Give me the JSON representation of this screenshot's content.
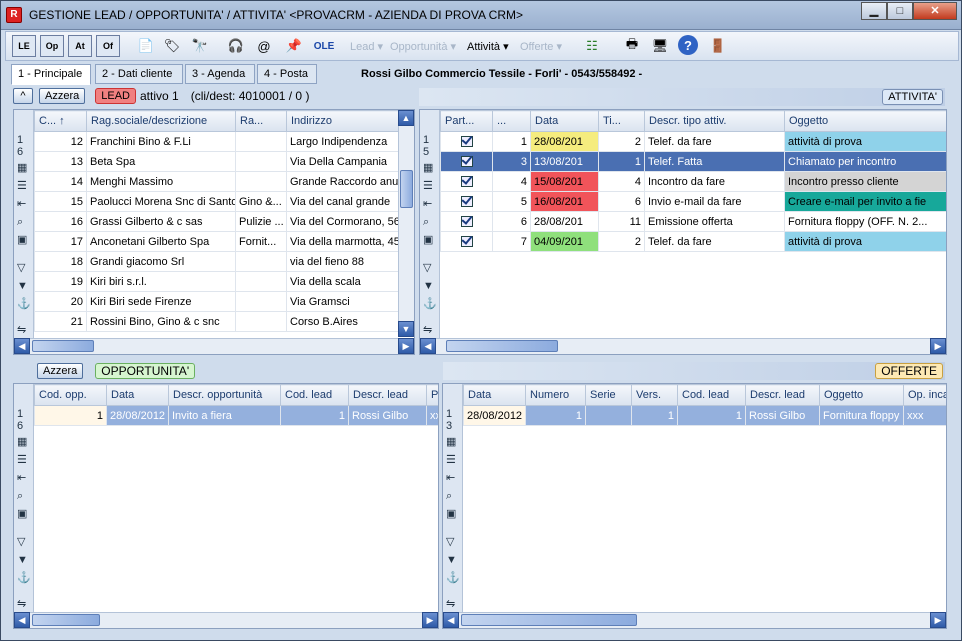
{
  "window": {
    "title": "GESTIONE LEAD / OPPORTUNITA' / ATTIVITA' <PROVACRM - AZIENDA DI PROVA CRM>",
    "minimize": "▁",
    "maximize": "□",
    "close": "✕"
  },
  "toolbar": {
    "btn1": "LE",
    "btn2": "Op",
    "btn3": "At",
    "btn4": "Of",
    "menus": [
      "Lead ▾",
      "Opportunità ▾",
      "Attività ▾",
      "Offerte ▾"
    ]
  },
  "tabs": [
    "1 - Principale",
    "2 - Dati cliente",
    "3 - Agenda",
    "4 - Posta"
  ],
  "client_info": "Rossi Gilbo  Commercio Tessile  - Forli'  - 0543/558492 -",
  "lead": {
    "azzera": "Azzera",
    "badge": "LEAD",
    "status": "attivo 1",
    "dest": "(cli/dest: 4010001 / 0 )",
    "gutter": "1\n6",
    "columns": [
      "C...",
      "Rag.sociale/descrizione",
      "Ra...",
      "Indirizzo"
    ],
    "rows": [
      [
        "12",
        "Franchini Bino & F.Li",
        "",
        "Largo Indipendenza"
      ],
      [
        "13",
        "Beta Spa",
        "",
        "Via Della Campania"
      ],
      [
        "14",
        "Menghi Massimo",
        "",
        "Grande Raccordo anulare"
      ],
      [
        "15",
        "Paolucci Morena Snc di Santoli",
        "Gino &...",
        "Via del canal grande"
      ],
      [
        "16",
        "Grassi Gilberto & c sas",
        "Pulizie ...",
        "Via del Cormorano, 56"
      ],
      [
        "17",
        "Anconetani Gilberto Spa",
        "Fornit...",
        "Via della marmotta, 45"
      ],
      [
        "18",
        "Grandi giacomo Srl",
        "",
        "via del fieno 88"
      ],
      [
        "19",
        "Kiri biri s.r.l.",
        "",
        "Via della scala"
      ],
      [
        "20",
        "Kiri Biri sede Firenze",
        "",
        "Via Gramsci"
      ],
      [
        "21",
        "Rossini Bino, Gino  & c snc",
        "",
        "Corso B.Aires"
      ]
    ]
  },
  "attivita": {
    "header": "ATTIVITA'",
    "gutter": "1\n5",
    "columns": [
      "Part...",
      "...",
      "Data",
      "Ti...",
      "Descr. tipo attiv.",
      "Oggetto"
    ],
    "rows": [
      [
        "",
        "1",
        "28/08/201",
        "2",
        "Telef. da fare",
        "attività di prova"
      ],
      [
        "",
        "3",
        "13/08/201",
        "1",
        "Telef. Fatta",
        "Chiamato per incontro"
      ],
      [
        "",
        "4",
        "15/08/201",
        "4",
        "Incontro da fare",
        "Incontro presso cliente"
      ],
      [
        "",
        "5",
        "16/08/201",
        "6",
        "Invio e-mail da fare",
        "Creare e-mail per invito a fie"
      ],
      [
        "",
        "6",
        "28/08/201",
        "11",
        "Emissione offerta",
        "Fornitura floppy (OFF. N. 2..."
      ],
      [
        "",
        "7",
        "04/09/201",
        "2",
        "Telef. da fare",
        "attività di prova"
      ]
    ]
  },
  "opportunita": {
    "azzera": "Azzera",
    "header": "OPPORTUNITA'",
    "gutter": "1\n6",
    "columns": [
      "Cod. opp.",
      "Data",
      "Descr. opportunità",
      "Cod. lead",
      "Descr. lead",
      "Pr"
    ],
    "rows": [
      [
        "1",
        "28/08/2012",
        "Invito a fiera",
        "1",
        "Rossi Gilbo",
        "xx"
      ]
    ]
  },
  "offerte": {
    "header": "OFFERTE",
    "gutter": "1\n3",
    "columns": [
      "Data",
      "Numero",
      "Serie",
      "Vers.",
      "Cod. lead",
      "Descr. lead",
      "Oggetto",
      "Op. inca"
    ],
    "rows": [
      [
        "28/08/2012",
        "1",
        "",
        "1",
        "1",
        "Rossi Gilbo",
        "Fornitura floppy",
        "xxx"
      ]
    ]
  },
  "colors": {
    "accent": "#4a6fb2",
    "yellow": "#f5ec7e",
    "red": "#f1545a",
    "green": "#8fe07c",
    "cyan": "#8fd2ea",
    "orange": "#f5c14a",
    "teal": "#17a89a"
  }
}
